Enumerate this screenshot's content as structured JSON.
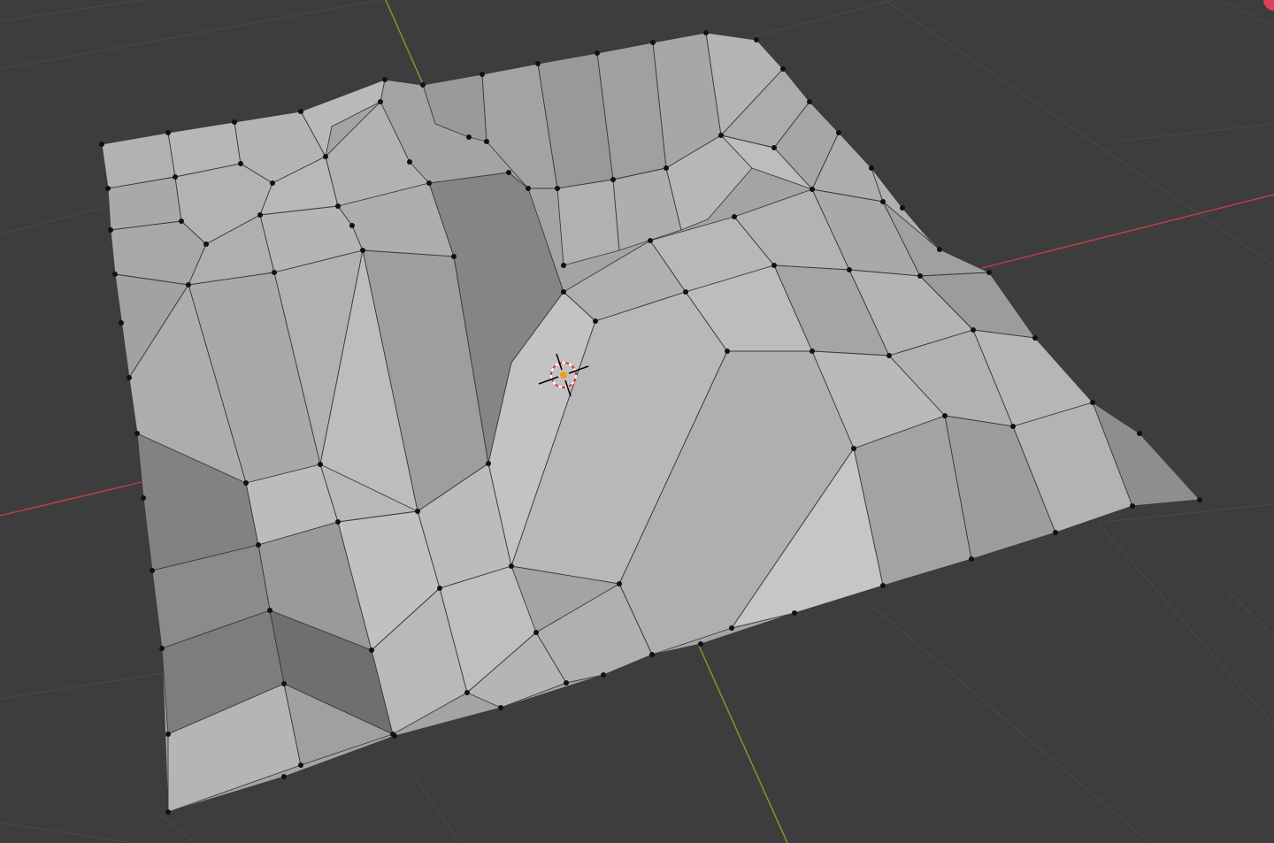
{
  "viewport": {
    "background": "#3d3d3d",
    "grid_color": "#4a4a4a",
    "x_axis_color": "#c83c4b",
    "y_axis_color": "#7aa22a",
    "mesh_face_color": "#a8a8a8",
    "mesh_edge_color": "#2e2e2e",
    "vertex_color": "#111111"
  },
  "icons": {
    "cursor": "3d-cursor-icon",
    "gizmo": "navigation-gizmo-icon"
  }
}
